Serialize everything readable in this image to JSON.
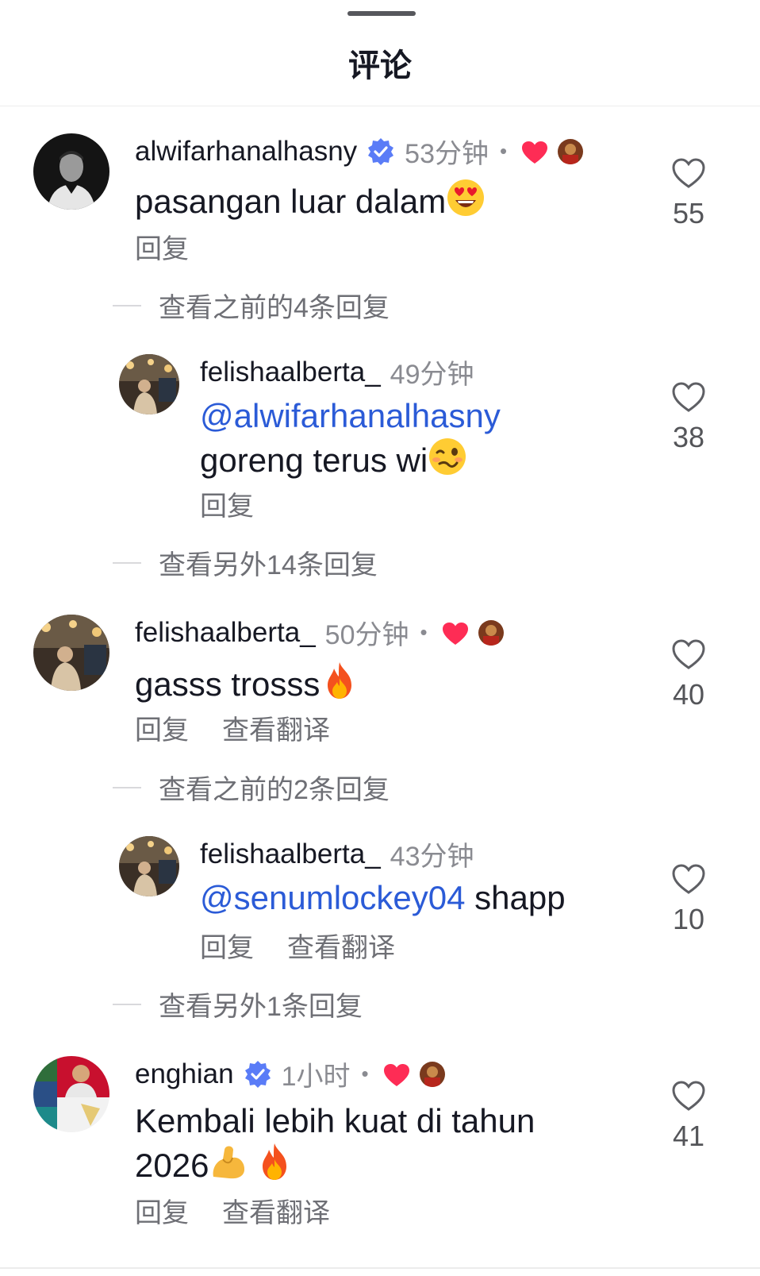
{
  "sheet": {
    "title": "评论"
  },
  "colors": {
    "mention": "#2b5bd7",
    "like_red": "#fe2c55",
    "verified": "#5a7cf7",
    "secondary_text": "#8a8b91"
  },
  "comments": [
    {
      "username": "alwifarhanalhasny",
      "verified": true,
      "time": "53分钟",
      "creator_liked": true,
      "text": "pasangan luar dalam",
      "emoji": "heart-eyes-emoji",
      "actions": [
        "回复"
      ],
      "likes": "55",
      "view_previous": "查看之前的4条回复",
      "reply": {
        "username": "felishaalberta_",
        "time": "49分钟",
        "mention": "@alwifarhanalhasny",
        "text": "goreng terus wi",
        "emoji": "woozy-face-emoji",
        "actions": [
          "回复"
        ],
        "likes": "38"
      },
      "view_more": "查看另外14条回复"
    },
    {
      "username": "felishaalberta_",
      "verified": false,
      "time": "50分钟",
      "creator_liked": true,
      "text": "gasss trosss",
      "emoji": "fire-emoji",
      "actions": [
        "回复",
        "查看翻译"
      ],
      "likes": "40",
      "view_previous": "查看之前的2条回复",
      "reply": {
        "username": "felishaalberta_",
        "time": "43分钟",
        "mention": "@senumlockey04",
        "text": " shapp",
        "actions": [
          "回复",
          "查看翻译"
        ],
        "likes": "10"
      },
      "view_more": "查看另外1条回复"
    },
    {
      "username": "enghian",
      "verified": true,
      "time": "1小时",
      "creator_liked": true,
      "text_line1": "Kembali lebih kuat di tahun",
      "text_line2": "2026",
      "emojis": [
        "flexed-biceps-emoji",
        "fire-emoji"
      ],
      "actions": [
        "回复",
        "查看翻译"
      ],
      "likes": "41"
    }
  ],
  "separator": "•"
}
